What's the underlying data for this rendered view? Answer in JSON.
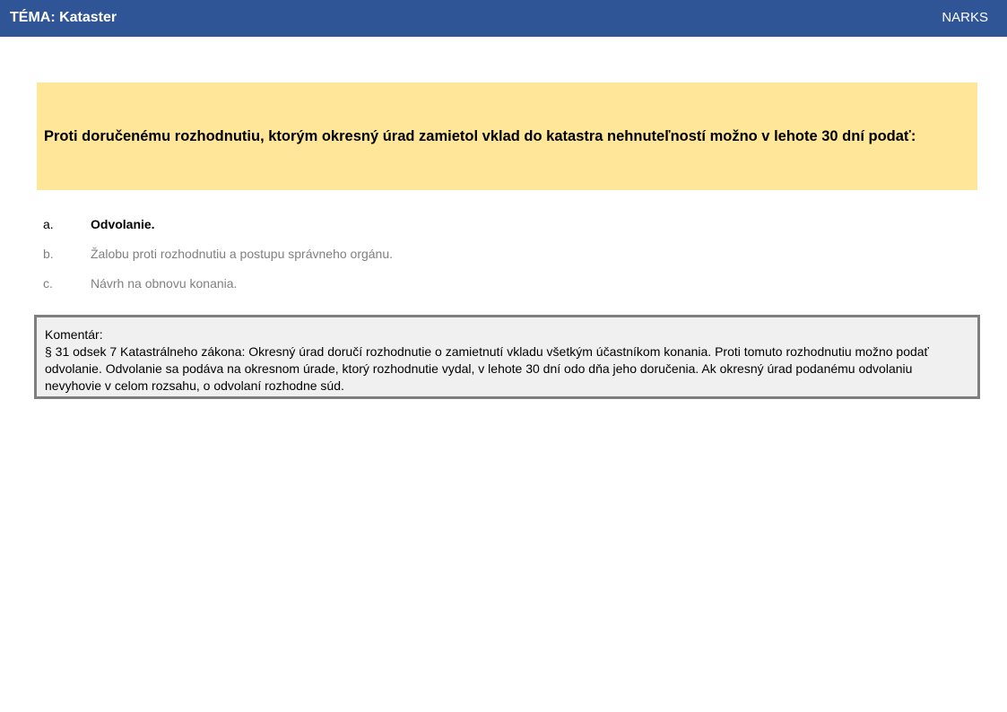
{
  "header": {
    "title": "TÉMA: Kataster",
    "brand": "NARKS",
    "background_color": "#2f5597"
  },
  "question": {
    "text": "Proti doručenému rozhodnutiu, ktorým okresný úrad zamietol vklad do katastra nehnuteľností možno v lehote 30 dní podať:",
    "background_color": "#ffe699"
  },
  "answers": [
    {
      "letter": "a.",
      "text": "Odvolanie.",
      "correct": true
    },
    {
      "letter": "b.",
      "text": "Žalobu proti rozhodnutiu a postupu správneho orgánu.",
      "correct": false
    },
    {
      "letter": "c.",
      "text": "Návrh na obnovu konania.",
      "correct": false
    }
  ],
  "comment": {
    "label": "Komentár:",
    "text": "§ 31 odsek 7 Katastrálneho zákona: Okresný úrad doručí rozhodnutie o zamietnutí vkladu všetkým účastníkom konania. Proti tomuto rozhodnutiu možno podať odvolanie. Odvolanie sa podáva na okresnom úrade, ktorý rozhodnutie vydal, v lehote 30 dní odo dňa jeho doručenia. Ak okresný úrad podanému odvolaniu nevyhovie v celom rozsahu, o odvolaní rozhodne súd."
  }
}
